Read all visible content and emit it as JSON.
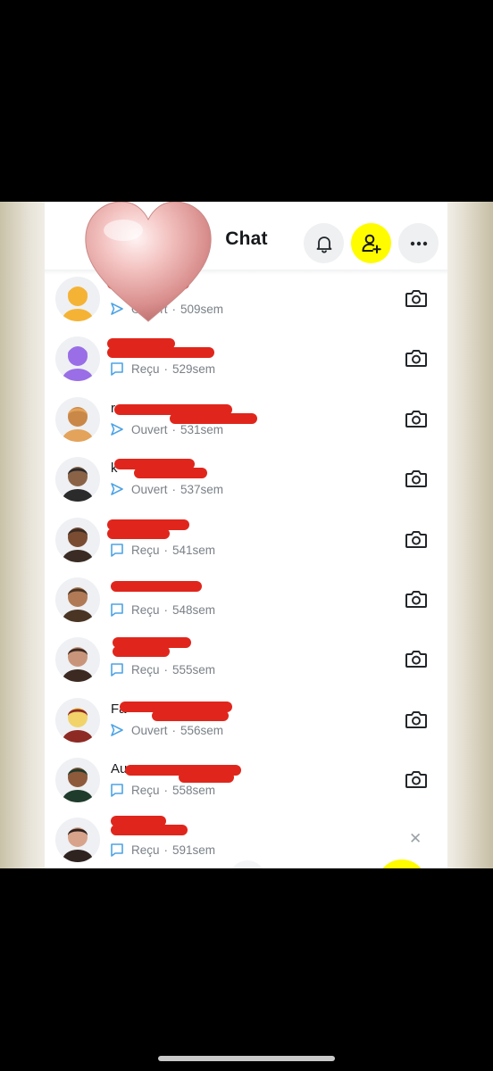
{
  "header": {
    "title": "Chat"
  },
  "colors": {
    "accent_yellow": "#fffc00",
    "sent_blue": "#4da3e5",
    "received_blue": "#4da3e5",
    "redaction_red": "#e0261c"
  },
  "chats": [
    {
      "name": "",
      "status_icon": "sent-arrow-icon",
      "status": "Ouvert",
      "time": "509sem",
      "action": "camera-icon"
    },
    {
      "name": "",
      "status_icon": "chat-bubble-icon",
      "status": "Reçu",
      "time": "529sem",
      "action": "camera-icon"
    },
    {
      "name": "r",
      "status_icon": "sent-arrow-icon",
      "status": "Ouvert",
      "time": "531sem",
      "action": "camera-icon"
    },
    {
      "name": "k",
      "status_icon": "sent-arrow-icon",
      "status": "Ouvert",
      "time": "537sem",
      "action": "camera-icon"
    },
    {
      "name": "",
      "status_icon": "chat-bubble-icon",
      "status": "Reçu",
      "time": "541sem",
      "action": "camera-icon"
    },
    {
      "name": "",
      "status_icon": "chat-bubble-icon",
      "status": "Reçu",
      "time": "548sem",
      "action": "camera-icon"
    },
    {
      "name": "",
      "status_icon": "chat-bubble-icon",
      "status": "Reçu",
      "time": "555sem",
      "action": "camera-icon"
    },
    {
      "name": "Fa",
      "status_icon": "sent-arrow-icon",
      "status": "Ouvert",
      "time": "556sem",
      "action": "camera-icon"
    },
    {
      "name": "Au",
      "status_icon": "chat-bubble-icon",
      "status": "Reçu",
      "time": "558sem",
      "action": "camera-icon"
    },
    {
      "name": "",
      "status_icon": "chat-bubble-icon",
      "status": "Reçu",
      "time": "591sem",
      "action": "close-icon"
    }
  ],
  "separator": "·"
}
